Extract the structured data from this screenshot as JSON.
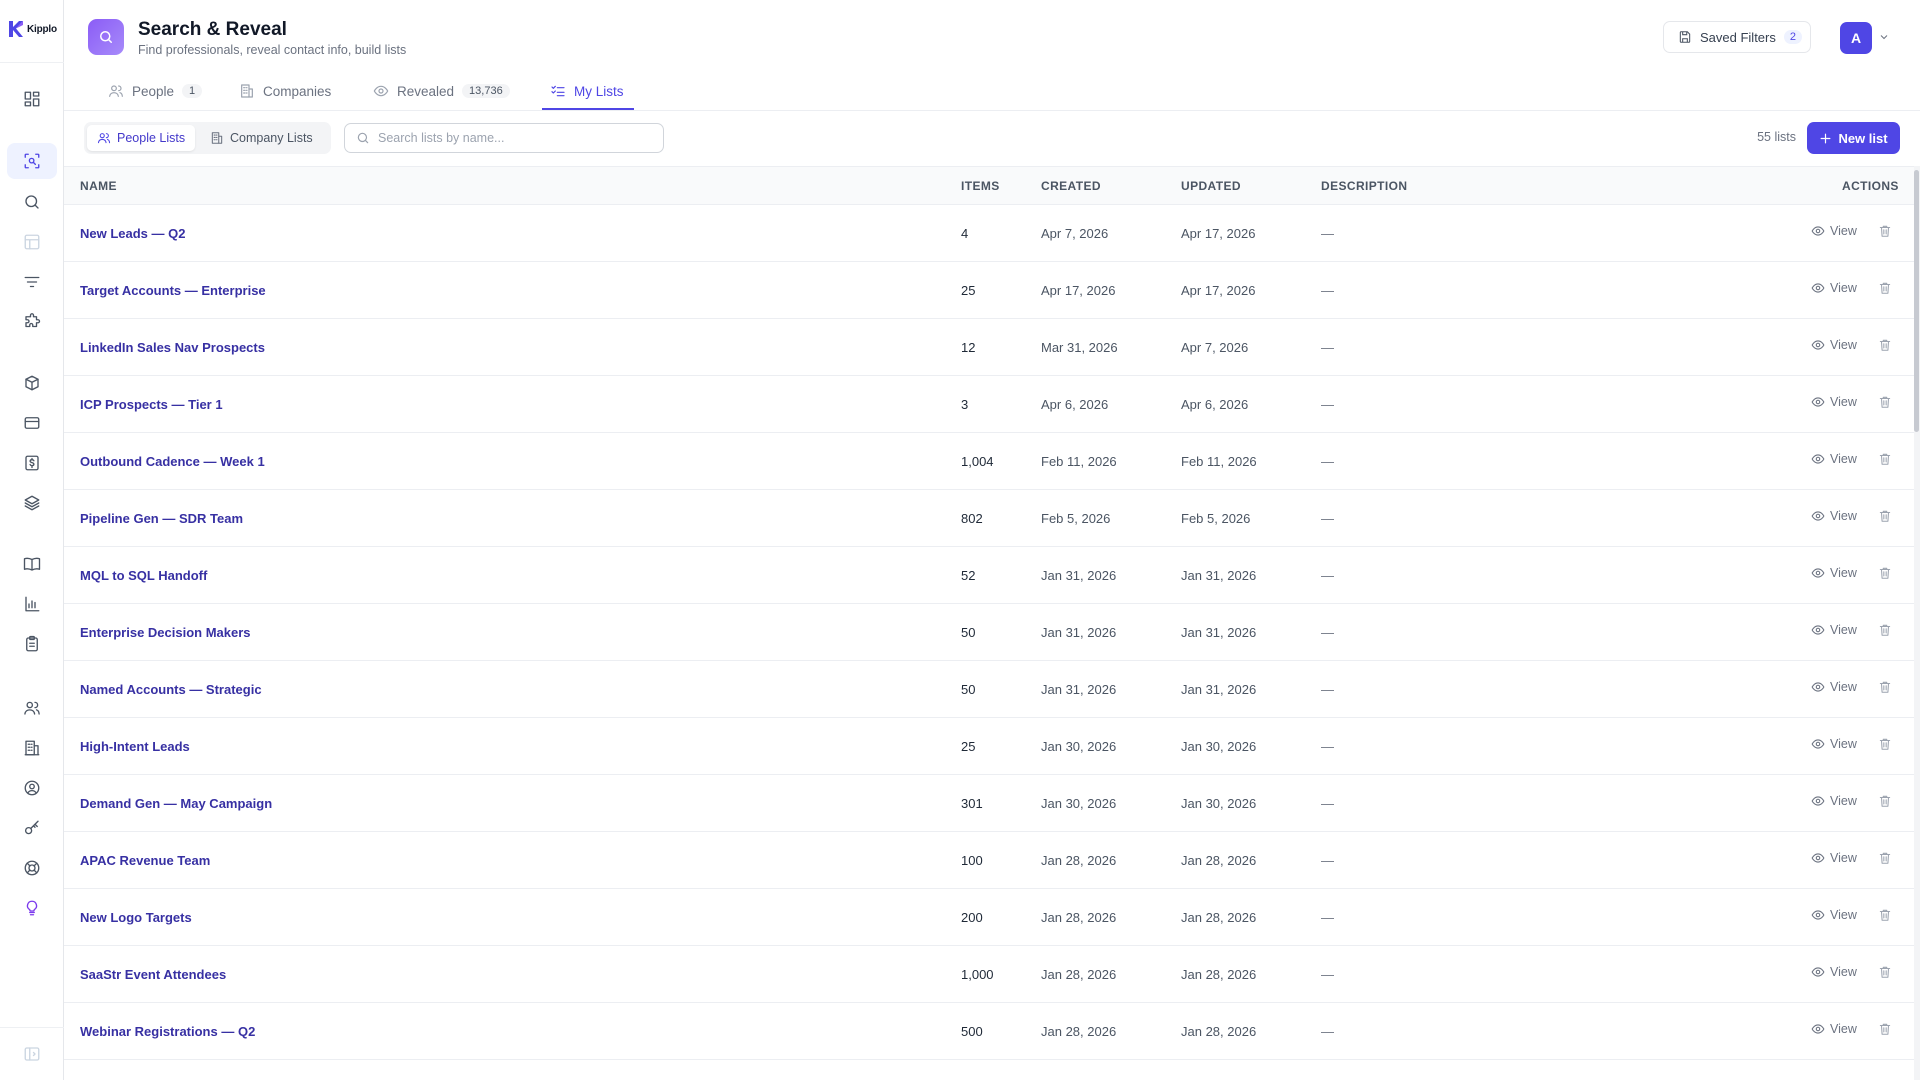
{
  "brand": {
    "name": "Kipplo"
  },
  "header": {
    "title": "Search & Reveal",
    "subtitle": "Find professionals, reveal contact info, build lists",
    "saved_filters_label": "Saved Filters",
    "saved_filters_count": "2",
    "avatar_initial": "A"
  },
  "tabs": [
    {
      "label": "People",
      "count": "1",
      "icon": "person-icon"
    },
    {
      "label": "Companies",
      "count": "",
      "icon": "building-icon"
    },
    {
      "label": "Revealed",
      "count": "13,736",
      "icon": "eye-icon"
    },
    {
      "label": "My Lists",
      "count": "",
      "icon": "list-check-icon",
      "active": true
    }
  ],
  "toolbar": {
    "people_lists_label": "People Lists",
    "company_lists_label": "Company Lists",
    "search_placeholder": "Search lists by name...",
    "list_count": "55 lists",
    "new_list_label": "New list"
  },
  "table": {
    "headers": {
      "name": "NAME",
      "items": "ITEMS",
      "created": "CREATED",
      "updated": "UPDATED",
      "description": "DESCRIPTION",
      "actions": "ACTIONS"
    },
    "view_label": "View",
    "rows": [
      {
        "name": "New Leads — Q2",
        "items": "4",
        "created": "Apr 7, 2026",
        "updated": "Apr 17, 2026",
        "description": "—"
      },
      {
        "name": "Target Accounts — Enterprise",
        "items": "25",
        "created": "Apr 17, 2026",
        "updated": "Apr 17, 2026",
        "description": "—"
      },
      {
        "name": "LinkedIn Sales Nav Prospects",
        "items": "12",
        "created": "Mar 31, 2026",
        "updated": "Apr 7, 2026",
        "description": "—"
      },
      {
        "name": "ICP Prospects — Tier 1",
        "items": "3",
        "created": "Apr 6, 2026",
        "updated": "Apr 6, 2026",
        "description": "—"
      },
      {
        "name": "Outbound Cadence — Week 1",
        "items": "1,004",
        "created": "Feb 11, 2026",
        "updated": "Feb 11, 2026",
        "description": "—"
      },
      {
        "name": "Pipeline Gen — SDR Team",
        "items": "802",
        "created": "Feb 5, 2026",
        "updated": "Feb 5, 2026",
        "description": "—"
      },
      {
        "name": "MQL to SQL Handoff",
        "items": "52",
        "created": "Jan 31, 2026",
        "updated": "Jan 31, 2026",
        "description": "—"
      },
      {
        "name": "Enterprise Decision Makers",
        "items": "50",
        "created": "Jan 31, 2026",
        "updated": "Jan 31, 2026",
        "description": "—"
      },
      {
        "name": "Named Accounts — Strategic",
        "items": "50",
        "created": "Jan 31, 2026",
        "updated": "Jan 31, 2026",
        "description": "—"
      },
      {
        "name": "High-Intent Leads",
        "items": "25",
        "created": "Jan 30, 2026",
        "updated": "Jan 30, 2026",
        "description": "—"
      },
      {
        "name": "Demand Gen — May Campaign",
        "items": "301",
        "created": "Jan 30, 2026",
        "updated": "Jan 30, 2026",
        "description": "—"
      },
      {
        "name": "APAC Revenue Team",
        "items": "100",
        "created": "Jan 28, 2026",
        "updated": "Jan 28, 2026",
        "description": "—"
      },
      {
        "name": "New Logo Targets",
        "items": "200",
        "created": "Jan 28, 2026",
        "updated": "Jan 28, 2026",
        "description": "—"
      },
      {
        "name": "SaaStr Event Attendees",
        "items": "1,000",
        "created": "Jan 28, 2026",
        "updated": "Jan 28, 2026",
        "description": "—"
      },
      {
        "name": "Webinar Registrations — Q2",
        "items": "500",
        "created": "Jan 28, 2026",
        "updated": "Jan 28, 2026",
        "description": "—"
      }
    ]
  },
  "sidebar": {
    "icons": [
      "dashboard-icon",
      "search-reveal-icon",
      "search-icon",
      "table-icon",
      "filter-icon",
      "puzzle-icon",
      "box-icon",
      "credit-card-icon",
      "dollar-icon",
      "layers-icon",
      "book-icon",
      "bar-chart-icon",
      "clipboard-icon",
      "users-icon",
      "building-icon",
      "user-circle-icon",
      "key-icon",
      "lifebuoy-icon",
      "lightbulb-icon",
      "sidebar-toggle-icon"
    ]
  },
  "colors": {
    "accent": "#4f46e5",
    "brand_gradient_start": "#8b5cf6",
    "link": "#3730a3"
  }
}
